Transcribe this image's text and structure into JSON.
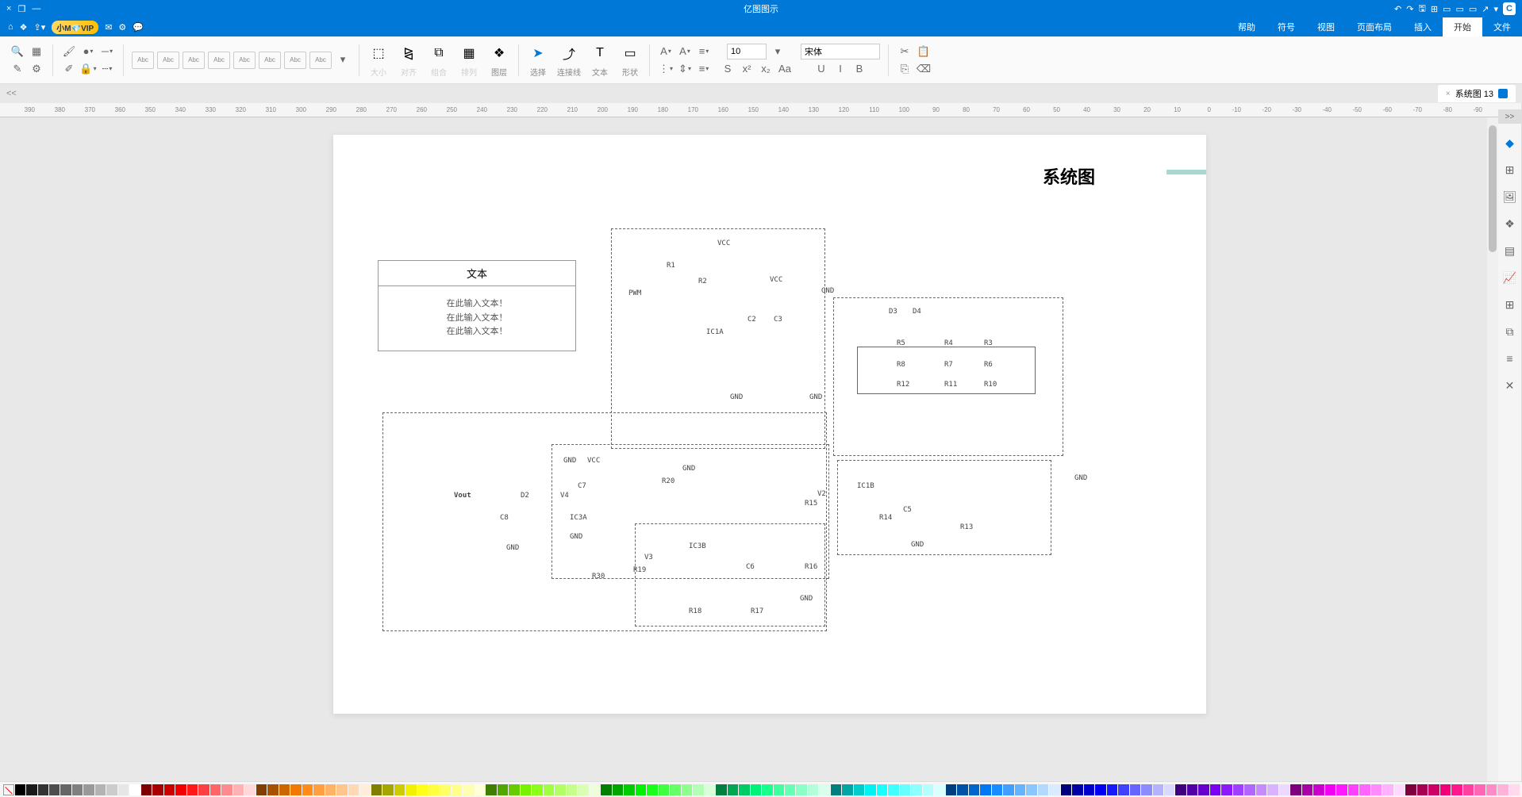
{
  "titlebar": {
    "title": "亿图图示",
    "logo": "C"
  },
  "menubar": {
    "vip": "VIP",
    "user": "小M",
    "menus": [
      "文件",
      "开始",
      "插入",
      "页面布局",
      "视图",
      "符号",
      "帮助"
    ],
    "active_index": 1
  },
  "ribbon": {
    "styles": [
      "Abc",
      "Abc",
      "Abc",
      "Abc",
      "Abc",
      "Abc",
      "Abc",
      "Abc"
    ],
    "groups": {
      "size": "大小",
      "align": "对齐",
      "group": "组合",
      "distribute": "排列",
      "layer": "图层",
      "select": "选择",
      "connector": "连接线",
      "text": "文本",
      "shape": "形状"
    },
    "font": "宋体",
    "size2": "10"
  },
  "tab": {
    "name": "系统图 13",
    "close": "×"
  },
  "ruler_ticks": [
    "-90",
    "-80",
    "-70",
    "-60",
    "-50",
    "-40",
    "-30",
    "-20",
    "-10",
    "0",
    "10",
    "20",
    "30",
    "40",
    "50",
    "60",
    "70",
    "80",
    "90",
    "100",
    "110",
    "120",
    "130",
    "140",
    "150",
    "160",
    "170",
    "180",
    "190",
    "200",
    "210",
    "220",
    "230",
    "240",
    "250",
    "260",
    "270",
    "280",
    "290",
    "300",
    "310",
    "320",
    "330",
    "340",
    "350",
    "360",
    "370",
    "380",
    "390"
  ],
  "canvas": {
    "title": "系统图",
    "textbox": {
      "head": "文本",
      "line": "在此输入文本！"
    }
  },
  "circuit_labels": {
    "VCC": "VCC",
    "GND": "GND",
    "PWM": "PWM",
    "Vout": "Vout",
    "R1": "R1",
    "R2": "R2",
    "R3": "R3",
    "R4": "R4",
    "R5": "R5",
    "R6": "R6",
    "R7": "R7",
    "R8": "R8",
    "R10": "R10",
    "R11": "R11",
    "R12": "R12",
    "R13": "R13",
    "R14": "R14",
    "R15": "R15",
    "R16": "R16",
    "R17": "R17",
    "R18": "R18",
    "R19": "R19",
    "R20": "R20",
    "R30": "R30",
    "C2": "C2",
    "C3": "C3",
    "C5": "C5",
    "C6": "C6",
    "C7": "C7",
    "C8": "C8",
    "D2": "D2",
    "D3": "D3",
    "D4": "D4",
    "V2": "V2",
    "V3": "V3",
    "V4": "V4",
    "IC1A": "IC1A",
    "IC1B": "IC1B",
    "IC3A": "IC3A",
    "IC3B": "IC3B"
  },
  "colors": [
    "#000000",
    "#1a1a1a",
    "#333333",
    "#4d4d4d",
    "#666666",
    "#808080",
    "#999999",
    "#b3b3b3",
    "#cccccc",
    "#e6e6e6",
    "#ffffff",
    "#7f0000",
    "#a60000",
    "#cc0000",
    "#f20000",
    "#ff1919",
    "#ff4040",
    "#ff6666",
    "#ff8c8c",
    "#ffb3b3",
    "#ffd9d9",
    "#7f3f00",
    "#a65200",
    "#cc6600",
    "#f27900",
    "#ff8c19",
    "#ff9f40",
    "#ffb366",
    "#ffc68c",
    "#ffd9b3",
    "#ffecd9",
    "#7f7f00",
    "#a6a600",
    "#cccc00",
    "#f2f200",
    "#ffff19",
    "#ffff40",
    "#ffff66",
    "#ffff8c",
    "#ffffb3",
    "#ffffd9",
    "#3f7f00",
    "#52a600",
    "#66cc00",
    "#79f200",
    "#8cff19",
    "#9fff40",
    "#b3ff66",
    "#c6ff8c",
    "#d9ffb3",
    "#ecffd9",
    "#007f00",
    "#00a600",
    "#00cc00",
    "#00f200",
    "#19ff19",
    "#40ff40",
    "#66ff66",
    "#8cff8c",
    "#b3ffb3",
    "#d9ffd9",
    "#007f3f",
    "#00a652",
    "#00cc66",
    "#00f279",
    "#19ff8c",
    "#40ff9f",
    "#66ffb3",
    "#8cffc6",
    "#b3ffd9",
    "#d9ffec",
    "#007f7f",
    "#00a6a6",
    "#00cccc",
    "#00f2f2",
    "#19ffff",
    "#40ffff",
    "#66ffff",
    "#8cffff",
    "#b3ffff",
    "#d9ffff",
    "#003f7f",
    "#0052a6",
    "#0066cc",
    "#0079f2",
    "#198cff",
    "#409fff",
    "#66b3ff",
    "#8cc6ff",
    "#b3d9ff",
    "#d9ecff",
    "#00007f",
    "#0000a6",
    "#0000cc",
    "#0000f2",
    "#1919ff",
    "#4040ff",
    "#6666ff",
    "#8c8cff",
    "#b3b3ff",
    "#d9d9ff",
    "#3f007f",
    "#5200a6",
    "#6600cc",
    "#7900f2",
    "#8c19ff",
    "#9f40ff",
    "#b366ff",
    "#c68cff",
    "#d9b3ff",
    "#ecd9ff",
    "#7f007f",
    "#a600a6",
    "#cc00cc",
    "#f200f2",
    "#ff19ff",
    "#ff40ff",
    "#ff66ff",
    "#ff8cff",
    "#ffb3ff",
    "#ffd9ff",
    "#7f003f",
    "#a60052",
    "#cc0066",
    "#f20079",
    "#ff198c",
    "#ff409f",
    "#ff66b3",
    "#ff8cc6",
    "#ffb3d9",
    "#ffd9ec"
  ]
}
